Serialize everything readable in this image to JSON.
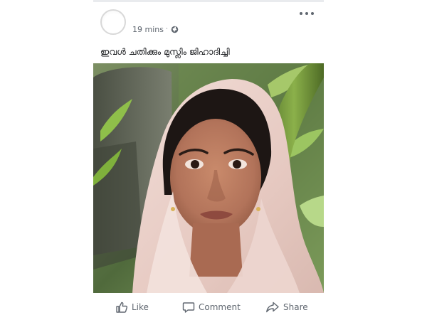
{
  "post": {
    "time": "19 mins",
    "separator": "·",
    "visibility_icon": "globe-icon",
    "menu_icon": "more-options-icon",
    "caption": "ഇവള്‍ ചതിക്കും മുസ്ലിം ജിഹാദിച്ചി"
  },
  "actions": {
    "like_label": "Like",
    "comment_label": "Comment",
    "share_label": "Share"
  },
  "colors": {
    "secondary_text": "#606770",
    "primary_text": "#1c1e21"
  }
}
